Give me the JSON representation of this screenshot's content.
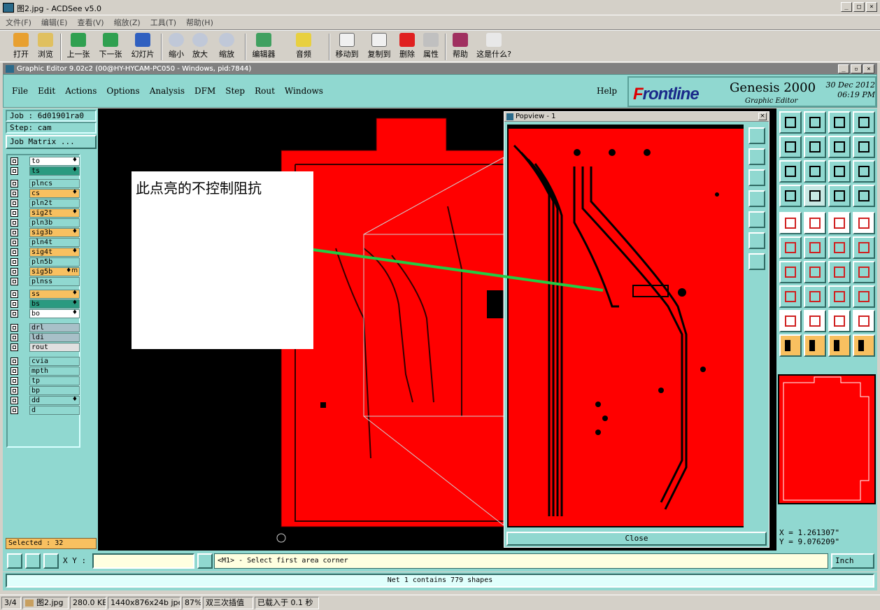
{
  "acdsee": {
    "title": "图2.jpg - ACDSee v5.0",
    "menu": [
      "文件(F)",
      "编辑(E)",
      "查看(V)",
      "缩放(Z)",
      "工具(T)",
      "帮助(H)"
    ],
    "toolbar": [
      "打开",
      "浏览",
      "上一张",
      "下一张",
      "幻灯片",
      "缩小",
      "放大",
      "缩放",
      "编辑器",
      "音频",
      "移动到",
      "复制到",
      "删除",
      "属性",
      "帮助",
      "这是什么?"
    ]
  },
  "editor": {
    "title": "Graphic Editor 9.02c2 (00@HY-HYCAM-PC050 - Windows, pid:7844)",
    "menu": [
      "File",
      "Edit",
      "Actions",
      "Options",
      "Analysis",
      "DFM",
      "Step",
      "Rout",
      "Windows"
    ],
    "help": "Help",
    "brand": {
      "logo_a": "F",
      "logo_b": "rontline",
      "product": "Genesis 2000",
      "subtitle": "Graphic Editor",
      "date": "30 Dec 2012",
      "time": "06:19 PM"
    },
    "job": "Job : 6d01901ra0",
    "step": "Step: cam",
    "job_matrix": "Job Matrix ...",
    "layers": [
      {
        "name": "to",
        "color": "#ffffff",
        "flag": "♦"
      },
      {
        "name": "ts",
        "color": "#2a9a80",
        "flag": "♦"
      },
      {
        "name": "plncs",
        "color": "#90d8d0",
        "flag": ""
      },
      {
        "name": "cs",
        "color": "#f8c060",
        "flag": "♦"
      },
      {
        "name": "pln2t",
        "color": "#90d8d0",
        "flag": ""
      },
      {
        "name": "sig2t",
        "color": "#f8c060",
        "flag": "♦"
      },
      {
        "name": "pln3b",
        "color": "#90d8d0",
        "flag": ""
      },
      {
        "name": "sig3b",
        "color": "#f8c060",
        "flag": "♦"
      },
      {
        "name": "pln4t",
        "color": "#90d8d0",
        "flag": ""
      },
      {
        "name": "sig4t",
        "color": "#f8c060",
        "flag": "♦"
      },
      {
        "name": "pln5b",
        "color": "#90d8d0",
        "flag": ""
      },
      {
        "name": "sig5b",
        "color": "#f8c060",
        "flag": "♦m"
      },
      {
        "name": "plnss",
        "color": "#90d8d0",
        "flag": ""
      },
      {
        "name": "ss",
        "color": "#f8c060",
        "flag": "♦"
      },
      {
        "name": "bs",
        "color": "#2a9a80",
        "flag": "♦"
      },
      {
        "name": "bo",
        "color": "#ffffff",
        "flag": "♦"
      },
      {
        "name": "drl",
        "color": "#a8c0c8",
        "flag": ""
      },
      {
        "name": "ldi",
        "color": "#a8c0c8",
        "flag": ""
      },
      {
        "name": "rout",
        "color": "#e0e0e0",
        "flag": ""
      },
      {
        "name": "cvia",
        "color": "#90d8d0",
        "flag": ""
      },
      {
        "name": "mpth",
        "color": "#90d8d0",
        "flag": ""
      },
      {
        "name": "tp",
        "color": "#90d8d0",
        "flag": ""
      },
      {
        "name": "bp",
        "color": "#90d8d0",
        "flag": ""
      },
      {
        "name": "dd",
        "color": "#90d8d0",
        "flag": "♦"
      },
      {
        "name": "d",
        "color": "#90d8d0",
        "flag": ""
      }
    ],
    "selected": "Selected : 32",
    "annotation": "此点亮的不控制阻抗",
    "popview": {
      "title": "Popview - 1",
      "close": "Close"
    },
    "coords": {
      "x": "X = 1.261307\"",
      "y": "Y = 9.076209\""
    },
    "xy_label": "X Y :",
    "prompt": "<M1> - Select first area corner",
    "unit": "Inch",
    "net_message": "Net 1 contains 779 shapes",
    "colors": {
      "board": "#ff0000",
      "panel": "#90d8d0",
      "trace": "#22cc44"
    }
  },
  "status": {
    "index": "3/4",
    "file": "图2.jpg",
    "size": "280.0 KB",
    "dims": "1440x876x24b jpeg",
    "zoom": "87%",
    "interp": "双三次插值",
    "loaded": "已载入于 0.1 秒"
  }
}
